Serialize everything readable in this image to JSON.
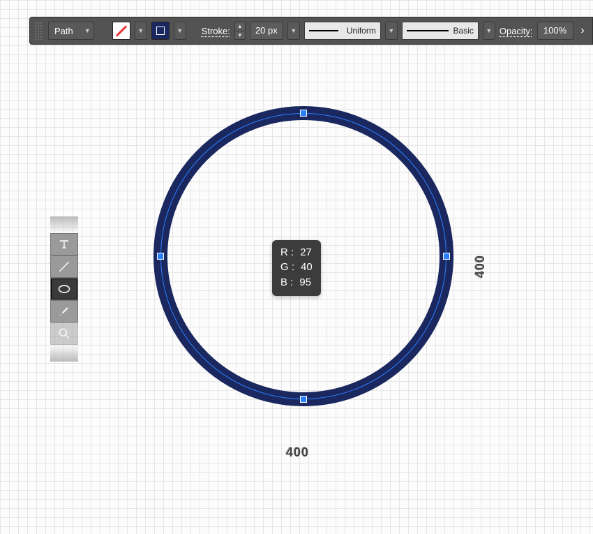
{
  "toolbar": {
    "object_type": "Path",
    "stroke_label": "Stroke:",
    "stroke_width": "20 px",
    "stroke_profile": "Uniform",
    "brush_type": "Basic",
    "opacity_label": "Opacity:",
    "opacity_value": "100%"
  },
  "tools": {
    "items": [
      "type",
      "line",
      "ellipse",
      "brush",
      "zoom"
    ],
    "active": "ellipse"
  },
  "shape": {
    "stroke_color": "#1b285f",
    "stroke_width_px": 20,
    "width": "400",
    "height": "400"
  },
  "color_tooltip": {
    "r_label": "R :",
    "r_value": "27",
    "g_label": "G :",
    "g_value": "40",
    "b_label": "B :",
    "b_value": "95"
  }
}
